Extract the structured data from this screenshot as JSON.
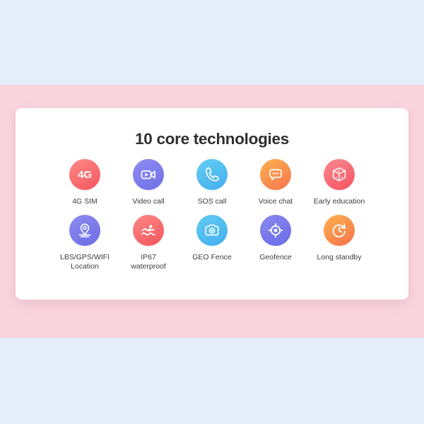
{
  "background": {
    "top_band_color": "#e4edf9",
    "middle_band_color": "#f9d4de",
    "bottom_band_color": "#e4edf9"
  },
  "card": {
    "title": "10 core technologies",
    "background_color": "#ffffff"
  },
  "technologies": {
    "row1": [
      {
        "label": "4G SIM",
        "icon": "4g-sim-icon",
        "icon_text": "4G",
        "color_start": "#fb8a86",
        "color_end": "#f5555f"
      },
      {
        "label": "Video call",
        "icon": "video-camera-icon",
        "color_start": "#8d8df2",
        "color_end": "#6f6fe8"
      },
      {
        "label": "SOS call",
        "icon": "phone-handset-icon",
        "color_start": "#63cdf3",
        "color_end": "#46aeee"
      },
      {
        "label": "Voice chat",
        "icon": "speech-bubble-icon",
        "color_start": "#fcb24f",
        "color_end": "#f5744f"
      },
      {
        "label": "Early education",
        "icon": "abc-block-icon",
        "color_start": "#fa8b90",
        "color_end": "#f4515f"
      }
    ],
    "row2": [
      {
        "label": "LBS/GPS/WIFI\nLocation",
        "icon": "map-pin-icon",
        "color_start": "#8d8df2",
        "color_end": "#6b6be6"
      },
      {
        "label": "IP67\nwaterproof",
        "icon": "swimmer-icon",
        "color_start": "#fb8a84",
        "color_end": "#f4535e"
      },
      {
        "label": "GEO Fence",
        "icon": "camera-icon",
        "color_start": "#62ccf3",
        "color_end": "#43aeef"
      },
      {
        "label": "Geofence",
        "icon": "target-locate-icon",
        "color_start": "#8a8af1",
        "color_end": "#6a6ae6"
      },
      {
        "label": "Long standby",
        "icon": "clock-refresh-icon",
        "color_start": "#fcb14d",
        "color_end": "#f5724f"
      }
    ]
  }
}
